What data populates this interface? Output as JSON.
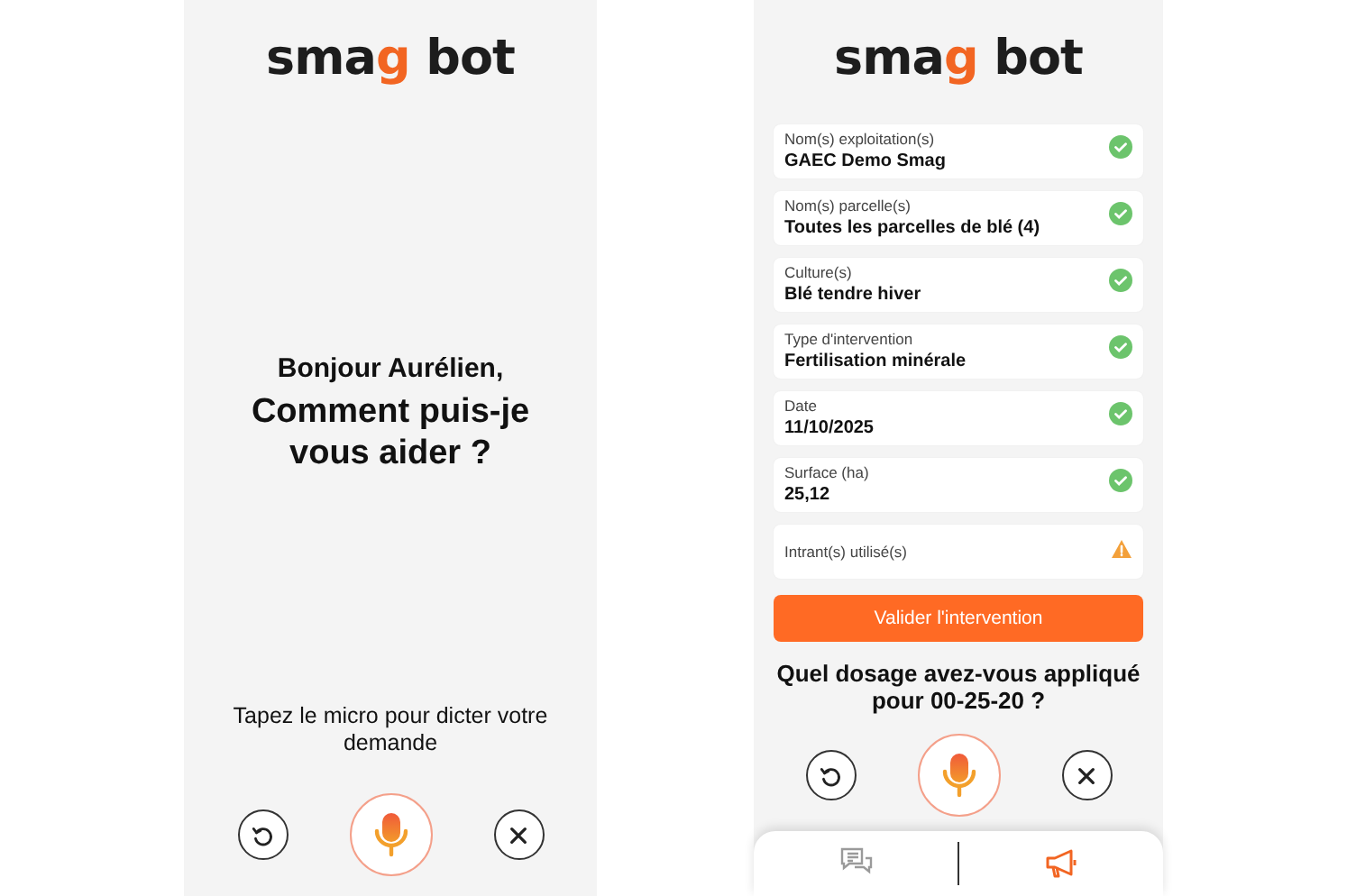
{
  "screens": [
    {
      "logo": {
        "before": "sma",
        "accent": "g",
        "after": " bot"
      },
      "greeting": "Bonjour Aurélien,",
      "headline": "Comment puis-je vous aider ?",
      "prompt": "Tapez le micro pour dicter votre demande"
    },
    {
      "logo": {
        "before": "sma",
        "accent": "g",
        "after": " bot"
      },
      "fields": [
        {
          "label": "Nom(s) exploitation(s)",
          "value": "GAEC Demo Smag",
          "valid": true
        },
        {
          "label": "Nom(s) parcelle(s)",
          "value": "Toutes les parcelles de blé (4)",
          "valid": true
        },
        {
          "label": "Culture(s)",
          "value": "Blé tendre hiver",
          "valid": true
        },
        {
          "label": "Type d'intervention",
          "value": "Fertilisation minérale",
          "valid": true
        },
        {
          "label": "Date",
          "value": "11/10/2025",
          "valid": true
        },
        {
          "label": "Surface (ha)",
          "value": "25,12",
          "valid": true
        },
        {
          "label": "Intrant(s) utilisé(s)",
          "valid": false
        }
      ],
      "submit": "Valider l'intervention",
      "prompt": "Quel dosage avez-vous appliqué pour 00-25-20 ?",
      "nav": [
        {
          "kind": "chat",
          "selected": false
        },
        {
          "kind": "megaphone",
          "selected": true
        }
      ]
    }
  ]
}
